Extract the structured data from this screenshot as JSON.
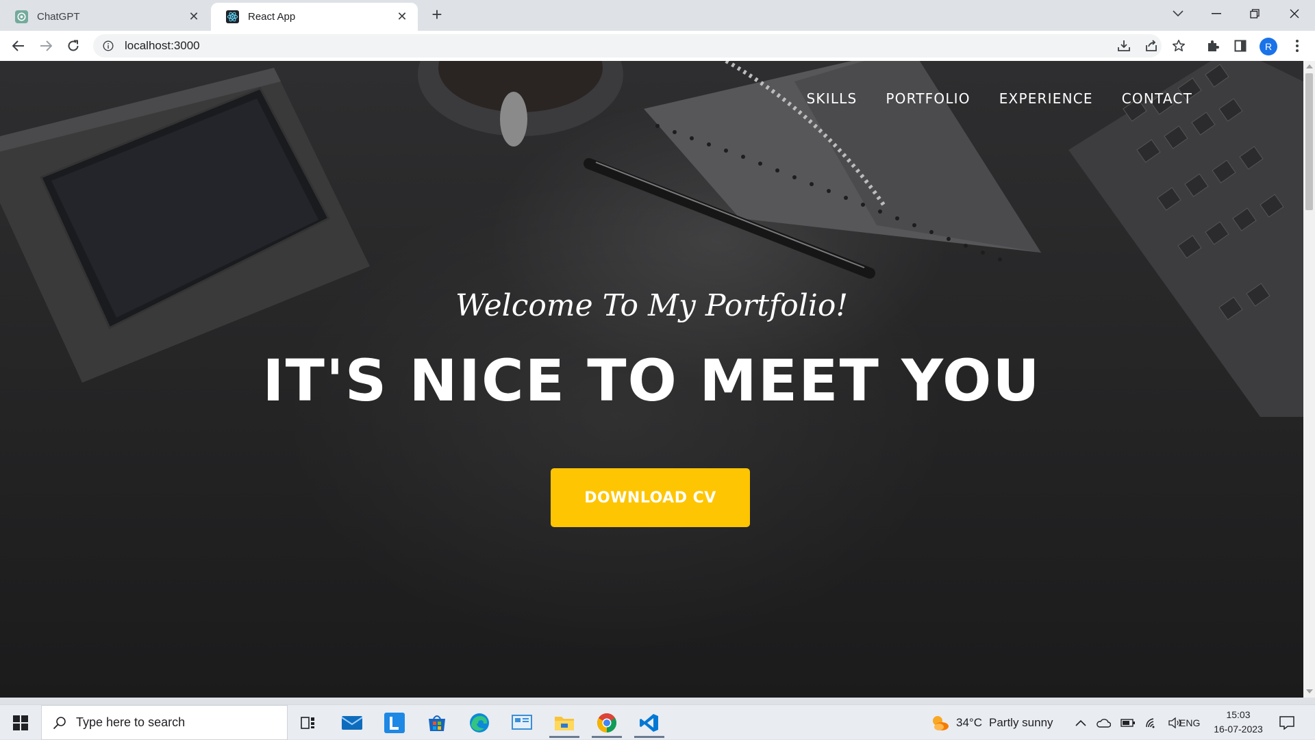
{
  "browser": {
    "tabs": [
      {
        "title": "ChatGPT",
        "active": false,
        "icon": "chatgpt-icon"
      },
      {
        "title": "React App",
        "active": true,
        "icon": "react-icon"
      }
    ],
    "url": "localhost:3000",
    "profile_initial": "R"
  },
  "page": {
    "nav": [
      "SKILLS",
      "PORTFOLIO",
      "EXPERIENCE",
      "CONTACT"
    ],
    "subtitle": "Welcome To My Portfolio!",
    "title": "IT'S NICE TO MEET YOU",
    "cta": "DOWNLOAD CV",
    "colors": {
      "accent": "#fec503",
      "text": "#ffffff"
    }
  },
  "taskbar": {
    "search_placeholder": "Type here to search",
    "weather_temp": "34°C",
    "weather_text": "Partly sunny",
    "language": "ENG",
    "time": "15:03",
    "date": "16-07-2023"
  }
}
